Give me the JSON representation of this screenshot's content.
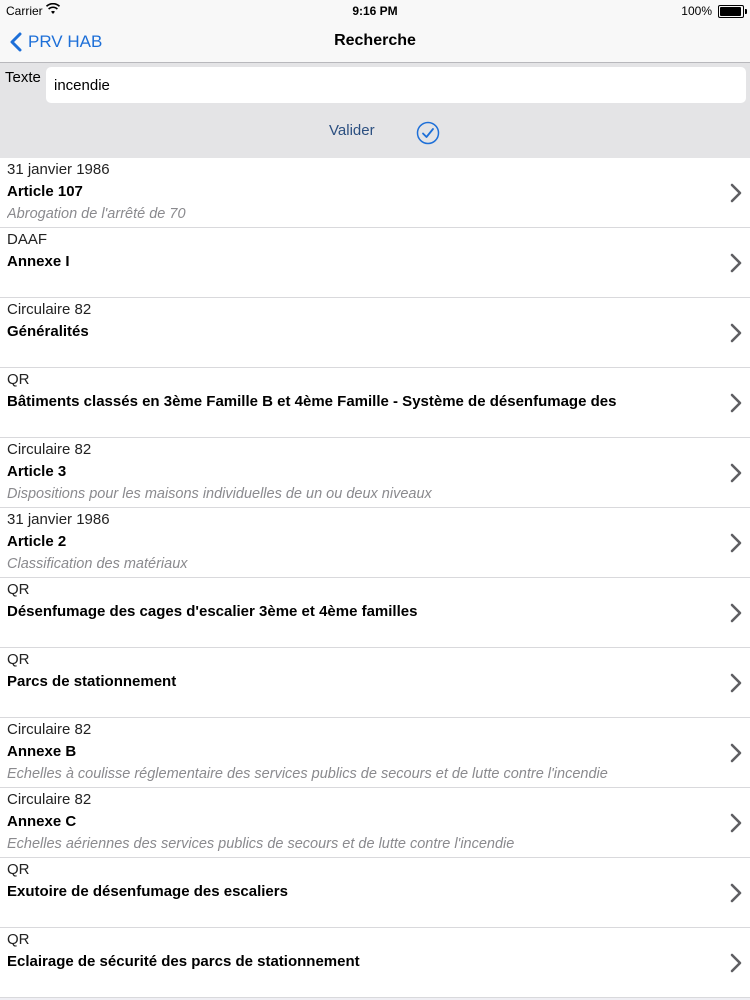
{
  "status_bar": {
    "carrier": "Carrier",
    "time": "9:16 PM",
    "battery": "100%"
  },
  "nav": {
    "back_label": "PRV HAB",
    "title": "Recherche"
  },
  "search": {
    "label": "Texte",
    "value": "incendie",
    "submit_label": "Valider"
  },
  "results": [
    {
      "source": "31 janvier 1986",
      "title": "Article 107",
      "subtitle": "Abrogation de l'arrêté de 70"
    },
    {
      "source": "DAAF",
      "title": "Annexe I",
      "subtitle": ""
    },
    {
      "source": "Circulaire 82",
      "title": "Généralités",
      "subtitle": ""
    },
    {
      "source": "QR",
      "title": "Bâtiments classés en 3ème Famille B et 4ème Famille - Système de désenfumage des",
      "subtitle": ""
    },
    {
      "source": "Circulaire 82",
      "title": "Article 3",
      "subtitle": "Dispositions pour les maisons individuelles de un ou deux niveaux"
    },
    {
      "source": "31 janvier 1986",
      "title": "Article 2",
      "subtitle": "Classification des matériaux"
    },
    {
      "source": "QR",
      "title": "Désenfumage des cages d'escalier 3ème et 4ème familles",
      "subtitle": ""
    },
    {
      "source": "QR",
      "title": "Parcs de stationnement",
      "subtitle": ""
    },
    {
      "source": "Circulaire 82",
      "title": "Annexe B",
      "subtitle": "Echelles à coulisse réglementaire des services publics de secours et de lutte contre l'incendie"
    },
    {
      "source": "Circulaire 82",
      "title": "Annexe C",
      "subtitle": "Echelles aériennes des services publics de secours et de lutte contre l'incendie"
    },
    {
      "source": "QR",
      "title": "Exutoire de désenfumage des escaliers",
      "subtitle": ""
    },
    {
      "source": "QR",
      "title": "Eclairage de sécurité des parcs de stationnement",
      "subtitle": ""
    }
  ],
  "colors": {
    "accent": "#1d6fd8",
    "valider": "#2b4f80",
    "subtitle": "#8a8a8e",
    "search_bg": "#e4e4e6"
  }
}
